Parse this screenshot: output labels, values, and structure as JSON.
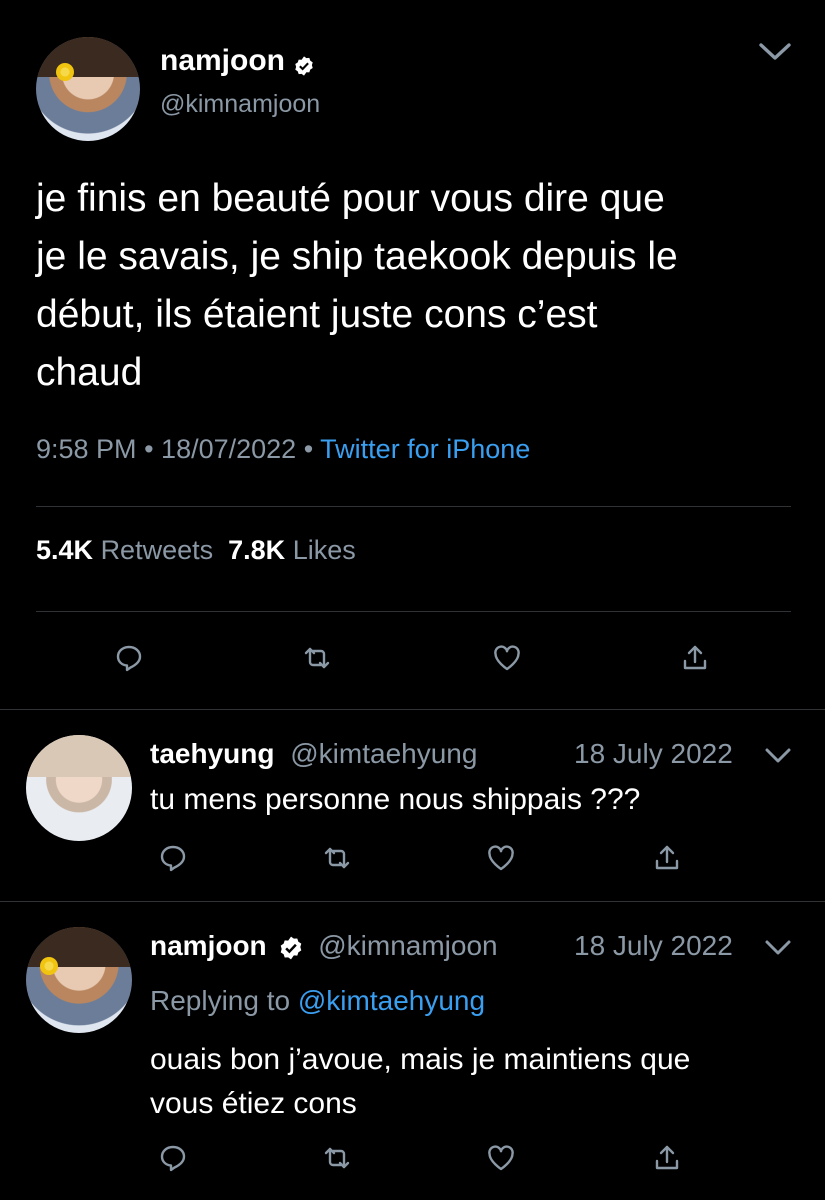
{
  "main_tweet": {
    "display_name": "namjoon",
    "handle": "@kimnamjoon",
    "text_lines": [
      "je finis en beauté pour vous dire que",
      "je le savais, je ship taekook depuis le",
      "début, ils étaient juste cons c’est",
      "chaud"
    ],
    "time": "9:58 PM",
    "separator": "•",
    "date": "18/07/2022",
    "source": "Twitter for iPhone",
    "retweet_count": "5.4K",
    "retweets_label": "Retweets",
    "like_count": "7.8K",
    "likes_label": "Likes"
  },
  "reply1": {
    "display_name": "taehyung",
    "handle": "@kimtaehyung",
    "date": "18 July 2022",
    "text": "tu mens personne nous shippais ???"
  },
  "reply2": {
    "display_name": "namjoon",
    "handle": "@kimnamjoon",
    "date": "18 July 2022",
    "replying_prefix": "Replying to",
    "replying_to": "@kimtaehyung",
    "text_lines": [
      "ouais bon j’avoue, mais je maintiens que",
      "vous étiez cons"
    ]
  },
  "colors": {
    "background": "#000000",
    "text": "#ffffff",
    "muted": "#8b98a5",
    "link": "#3a9ff0",
    "divider": "#2f3336"
  },
  "icons": [
    "chevron-down-icon",
    "verified-badge-icon",
    "reply-icon",
    "retweet-icon",
    "like-icon",
    "share-icon"
  ]
}
